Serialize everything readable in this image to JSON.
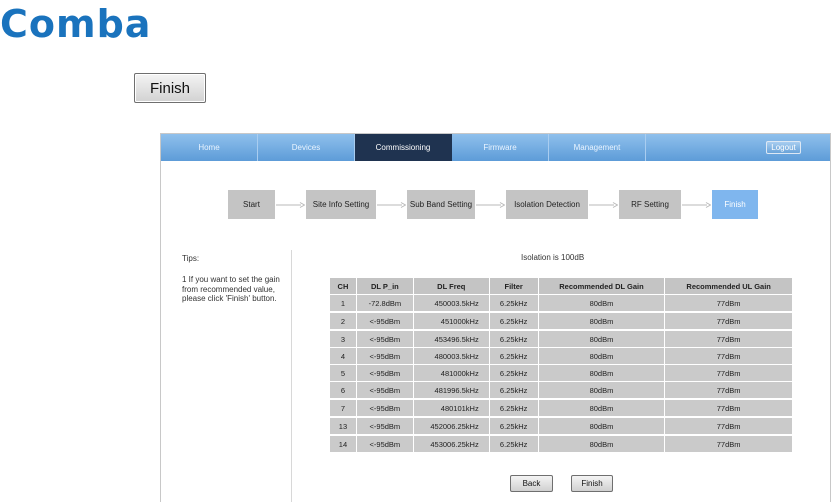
{
  "brand": {
    "logo_text": "Comba",
    "color": "#1a73bd"
  },
  "top_finish_button": "Finish",
  "nav": {
    "tabs": [
      "Home",
      "Devices",
      "Commissioning",
      "Firmware",
      "Management"
    ],
    "active": "Commissioning",
    "logout": "Logout"
  },
  "steps": [
    "Start",
    "Site Info Setting",
    "Sub Band Setting",
    "Isolation Detection",
    "RF Setting",
    "Finish"
  ],
  "current_step": "Finish",
  "tips": {
    "title": "Tips:",
    "text": "1 If you want to set the gain from recommended value, please click 'Finish' button."
  },
  "isolation": "Isolation is 100dB",
  "table": {
    "headers": [
      "CH",
      "DL P_in",
      "DL Freq",
      "Filter",
      "Recommended DL Gain",
      "Recommended UL Gain"
    ],
    "rows": [
      [
        "1",
        "-72.8dBm",
        "450003.5kHz",
        "6.25kHz",
        "80dBm",
        "77dBm"
      ],
      [
        "2",
        "<-95dBm",
        "451000kHz",
        "6.25kHz",
        "80dBm",
        "77dBm"
      ],
      [
        "3",
        "<-95dBm",
        "453496.5kHz",
        "6.25kHz",
        "80dBm",
        "77dBm"
      ],
      [
        "4",
        "<-95dBm",
        "480003.5kHz",
        "6.25kHz",
        "80dBm",
        "77dBm"
      ],
      [
        "5",
        "<-95dBm",
        "481000kHz",
        "6.25kHz",
        "80dBm",
        "77dBm"
      ],
      [
        "6",
        "<-95dBm",
        "481996.5kHz",
        "6.25kHz",
        "80dBm",
        "77dBm"
      ],
      [
        "7",
        "<-95dBm",
        "480101kHz",
        "6.25kHz",
        "80dBm",
        "77dBm"
      ],
      [
        "13",
        "<-95dBm",
        "452006.25kHz",
        "6.25kHz",
        "80dBm",
        "77dBm"
      ],
      [
        "14",
        "<-95dBm",
        "453006.25kHz",
        "6.25kHz",
        "80dBm",
        "77dBm"
      ]
    ]
  },
  "buttons": {
    "back": "Back",
    "finish": "Finish"
  }
}
